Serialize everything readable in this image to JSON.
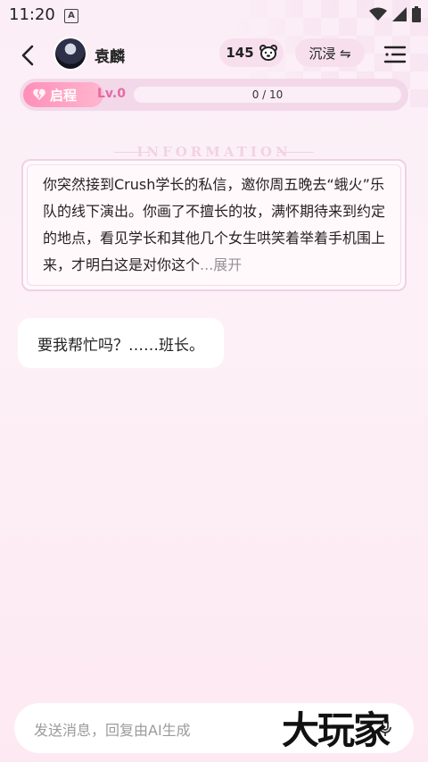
{
  "status_bar": {
    "time": "11:20",
    "badge": "A"
  },
  "header": {
    "name": "袁麟",
    "count": "145",
    "mode_label": "沉浸 ⇋"
  },
  "level": {
    "stage": "启程",
    "level": "Lv.0",
    "progress_text": "0 / 10",
    "progress_fraction": 0.0
  },
  "info": {
    "title": "INFORMATION",
    "text": "你突然接到Crush学长的私信，邀你周五晚去“蛾火”乐队的线下演出。你画了不擅长的妆，满怀期待来到约定的地点，看见学长和其他几个女生哄笑着举着手机围上来，才明白这是对你这个",
    "ellipsis": "...",
    "more_label": "展开"
  },
  "chat": {
    "message": "要我帮忙吗？……班长。"
  },
  "input": {
    "placeholder": "发送消息，回复由AI生成"
  },
  "watermark": {
    "text": "大玩家"
  },
  "colors": {
    "accent": "#f39ac5",
    "pill_bg": "#f7dfee",
    "stage_grad": "#ff8fb8"
  },
  "icons": {
    "back": "chevron-left-icon",
    "bear": "bear-icon",
    "swap": "swap-icon",
    "menu": "menu-icon",
    "heart": "broken-heart-icon",
    "wifi": "wifi-icon",
    "signal": "signal-icon",
    "battery": "battery-icon",
    "mic": "mic-icon"
  }
}
